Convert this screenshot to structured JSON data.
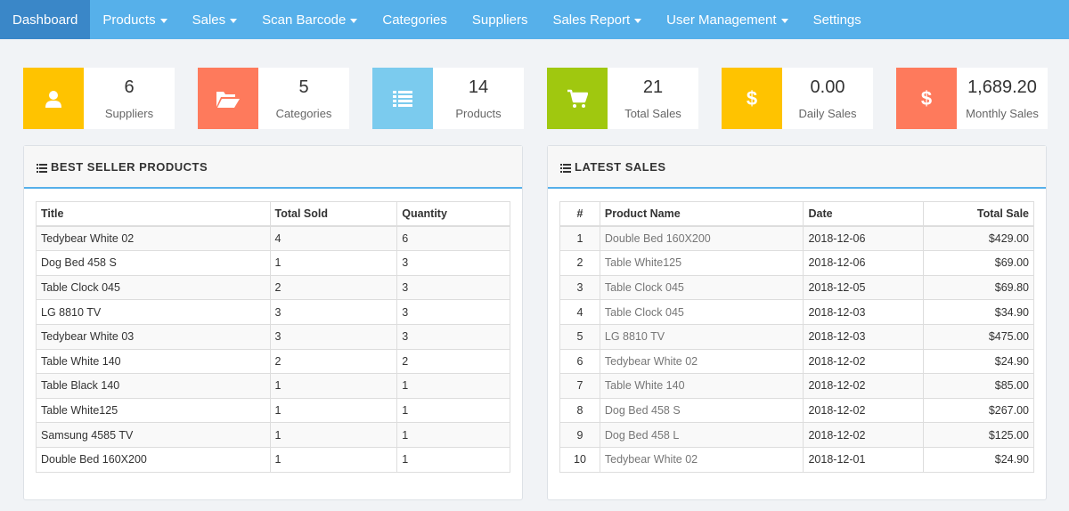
{
  "nav": {
    "items": [
      {
        "label": "Dashboard",
        "active": true,
        "dropdown": false
      },
      {
        "label": "Products",
        "dropdown": true
      },
      {
        "label": "Sales",
        "dropdown": true
      },
      {
        "label": "Scan Barcode",
        "dropdown": true
      },
      {
        "label": "Categories",
        "dropdown": false
      },
      {
        "label": "Suppliers",
        "dropdown": false
      },
      {
        "label": "Sales Report",
        "dropdown": true
      },
      {
        "label": "User Management",
        "dropdown": true
      },
      {
        "label": "Settings",
        "dropdown": false
      }
    ]
  },
  "stats": [
    {
      "value": "6",
      "label": "Suppliers",
      "icon": "user-icon",
      "color": "#ffc300"
    },
    {
      "value": "5",
      "label": "Categories",
      "icon": "folder-open-icon",
      "color": "#fe7a5c"
    },
    {
      "value": "14",
      "label": "Products",
      "icon": "list-icon",
      "color": "#7bcbee"
    },
    {
      "value": "21",
      "label": "Total Sales",
      "icon": "cart-icon",
      "color": "#a0c80f"
    },
    {
      "value": "0.00",
      "label": "Daily Sales",
      "icon": "dollar-icon",
      "glyph": "$",
      "color": "#ffc300"
    },
    {
      "value": "1,689.20",
      "label": "Monthly Sales",
      "icon": "dollar-icon",
      "glyph": "$",
      "color": "#fe7a5c"
    }
  ],
  "best_sellers": {
    "title": "BEST SELLER PRODUCTS",
    "columns": [
      "Title",
      "Total Sold",
      "Quantity"
    ],
    "rows": [
      [
        "Tedybear White 02",
        "4",
        "6"
      ],
      [
        "Dog Bed 458 S",
        "1",
        "3"
      ],
      [
        "Table Clock 045",
        "2",
        "3"
      ],
      [
        "LG 8810 TV",
        "3",
        "3"
      ],
      [
        "Tedybear White 03",
        "3",
        "3"
      ],
      [
        "Table White 140",
        "2",
        "2"
      ],
      [
        "Table Black 140",
        "1",
        "1"
      ],
      [
        "Table White125",
        "1",
        "1"
      ],
      [
        "Samsung 4585 TV",
        "1",
        "1"
      ],
      [
        "Double Bed 160X200",
        "1",
        "1"
      ]
    ]
  },
  "latest_sales": {
    "title": "LATEST SALES",
    "columns": [
      "#",
      "Product Name",
      "Date",
      "Total Sale"
    ],
    "rows": [
      [
        "1",
        "Double Bed 160X200",
        "2018-12-06",
        "$429.00"
      ],
      [
        "2",
        "Table White125",
        "2018-12-06",
        "$69.00"
      ],
      [
        "3",
        "Table Clock 045",
        "2018-12-05",
        "$69.80"
      ],
      [
        "4",
        "Table Clock 045",
        "2018-12-03",
        "$34.90"
      ],
      [
        "5",
        "LG 8810 TV",
        "2018-12-03",
        "$475.00"
      ],
      [
        "6",
        "Tedybear White 02",
        "2018-12-02",
        "$24.90"
      ],
      [
        "7",
        "Table White 140",
        "2018-12-02",
        "$85.00"
      ],
      [
        "8",
        "Dog Bed 458 S",
        "2018-12-02",
        "$267.00"
      ],
      [
        "9",
        "Dog Bed 458 L",
        "2018-12-02",
        "$125.00"
      ],
      [
        "10",
        "Tedybear White 02",
        "2018-12-01",
        "$24.90"
      ]
    ]
  }
}
